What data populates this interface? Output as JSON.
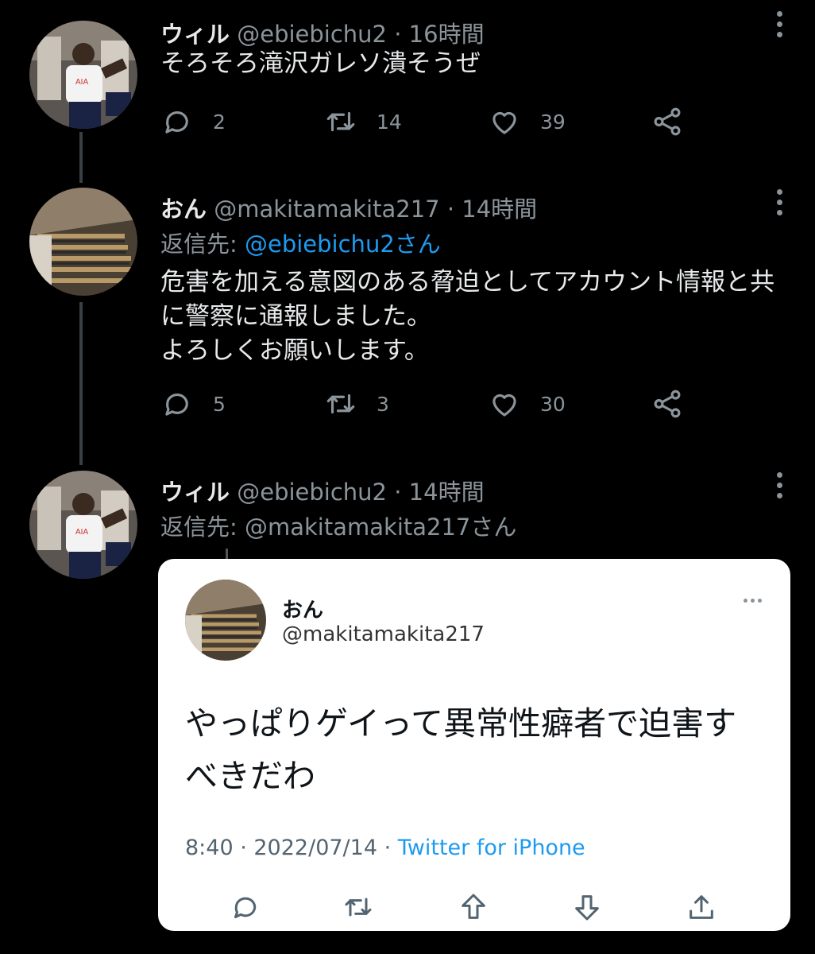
{
  "tweets": [
    {
      "name": "ウィル",
      "handle": "@ebiebichu2",
      "time": "16時間",
      "lines": [
        "そろそろ滝沢ガレソ潰そうぜ"
      ],
      "replies": "2",
      "retweets": "14",
      "likes": "39"
    },
    {
      "name": "おん",
      "handle": "@makitamakita217",
      "time": "14時間",
      "reply_prefix": "返信先: ",
      "reply_target": "@ebiebichu2さん",
      "lines": [
        "危害を加える意図のある脅迫としてアカウント情報と共",
        "に警察に通報しました。",
        "よろしくお願いします。"
      ],
      "replies": "5",
      "retweets": "3",
      "likes": "30"
    },
    {
      "name": "ウィル",
      "handle": "@ebiebichu2",
      "time": "14時間",
      "reply_line": "返信先: @makitamakita217さん"
    }
  ],
  "separator": " · ",
  "embedded": {
    "name": "おん",
    "handle": "@makitamakita217",
    "lines": [
      "やっぱりゲイって異常性癖者で迫害す",
      "べきだわ"
    ],
    "datetime": "8:40 · 2022/07/14 · ",
    "source": "Twitter for iPhone"
  },
  "colors": {
    "background": "#000000",
    "link": "#1d9bf0",
    "muted": "#8b949a",
    "card_background": "#ffffff"
  },
  "icons": [
    "reply-icon",
    "retweet-icon",
    "like-icon",
    "share-icon",
    "more-icon",
    "upvote-icon",
    "downvote-icon",
    "upload-icon"
  ]
}
